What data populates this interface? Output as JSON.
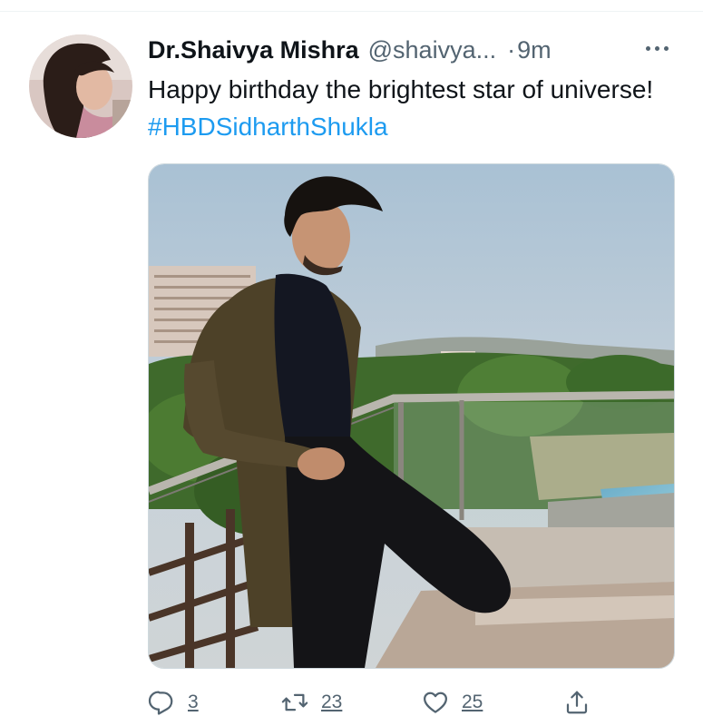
{
  "tweet": {
    "author": {
      "display_name": "Dr.Shaivya Mishra",
      "handle": "@shaivya..."
    },
    "dot": "·",
    "time": "9m",
    "text": "Happy birthday the brightest star of universe!",
    "hashtag": "#HBDSidharthShukla"
  },
  "actions": {
    "replies": "3",
    "retweets": "23",
    "likes": "25"
  },
  "icons": {
    "more": "more-horizontal-icon",
    "reply": "reply-icon",
    "retweet": "retweet-icon",
    "like": "heart-icon",
    "share": "share-icon"
  },
  "colors": {
    "text": "#0f1419",
    "secondary": "#536471",
    "link": "#1d9bf0",
    "border": "#cfd9de"
  }
}
